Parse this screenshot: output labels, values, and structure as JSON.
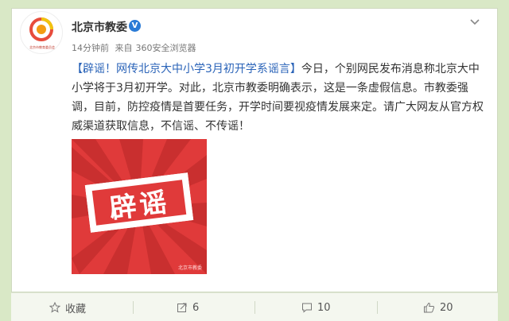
{
  "post": {
    "author": "北京市教委",
    "verified_mark": "V",
    "time": "14分钟前",
    "source_prefix": "来自",
    "source": "360安全浏览器",
    "avatar_caption": "北京市教育委员会",
    "content_tag": "【辟谣！网传北京大中小学3月初开学系谣言】",
    "content_body": "今日，个别网民发布消息称北京大中小学将于3月初开学。对此，北京市教委明确表示，这是一条虚假信息。市教委强调，目前，防控疫情是首要任务，开学时间要视疫情发展来定。请广大网友从官方权威渠道获取信息，不信谣、不传谣！",
    "image_text": "辟谣",
    "image_watermark": "北京市教委"
  },
  "actions": {
    "favorite_label": "收藏",
    "repost_count": "6",
    "comment_count": "10",
    "like_count": "20"
  },
  "colors": {
    "link": "#2a63b8",
    "stamp_red": "#e03a3a",
    "background": "#d9e8c6"
  }
}
